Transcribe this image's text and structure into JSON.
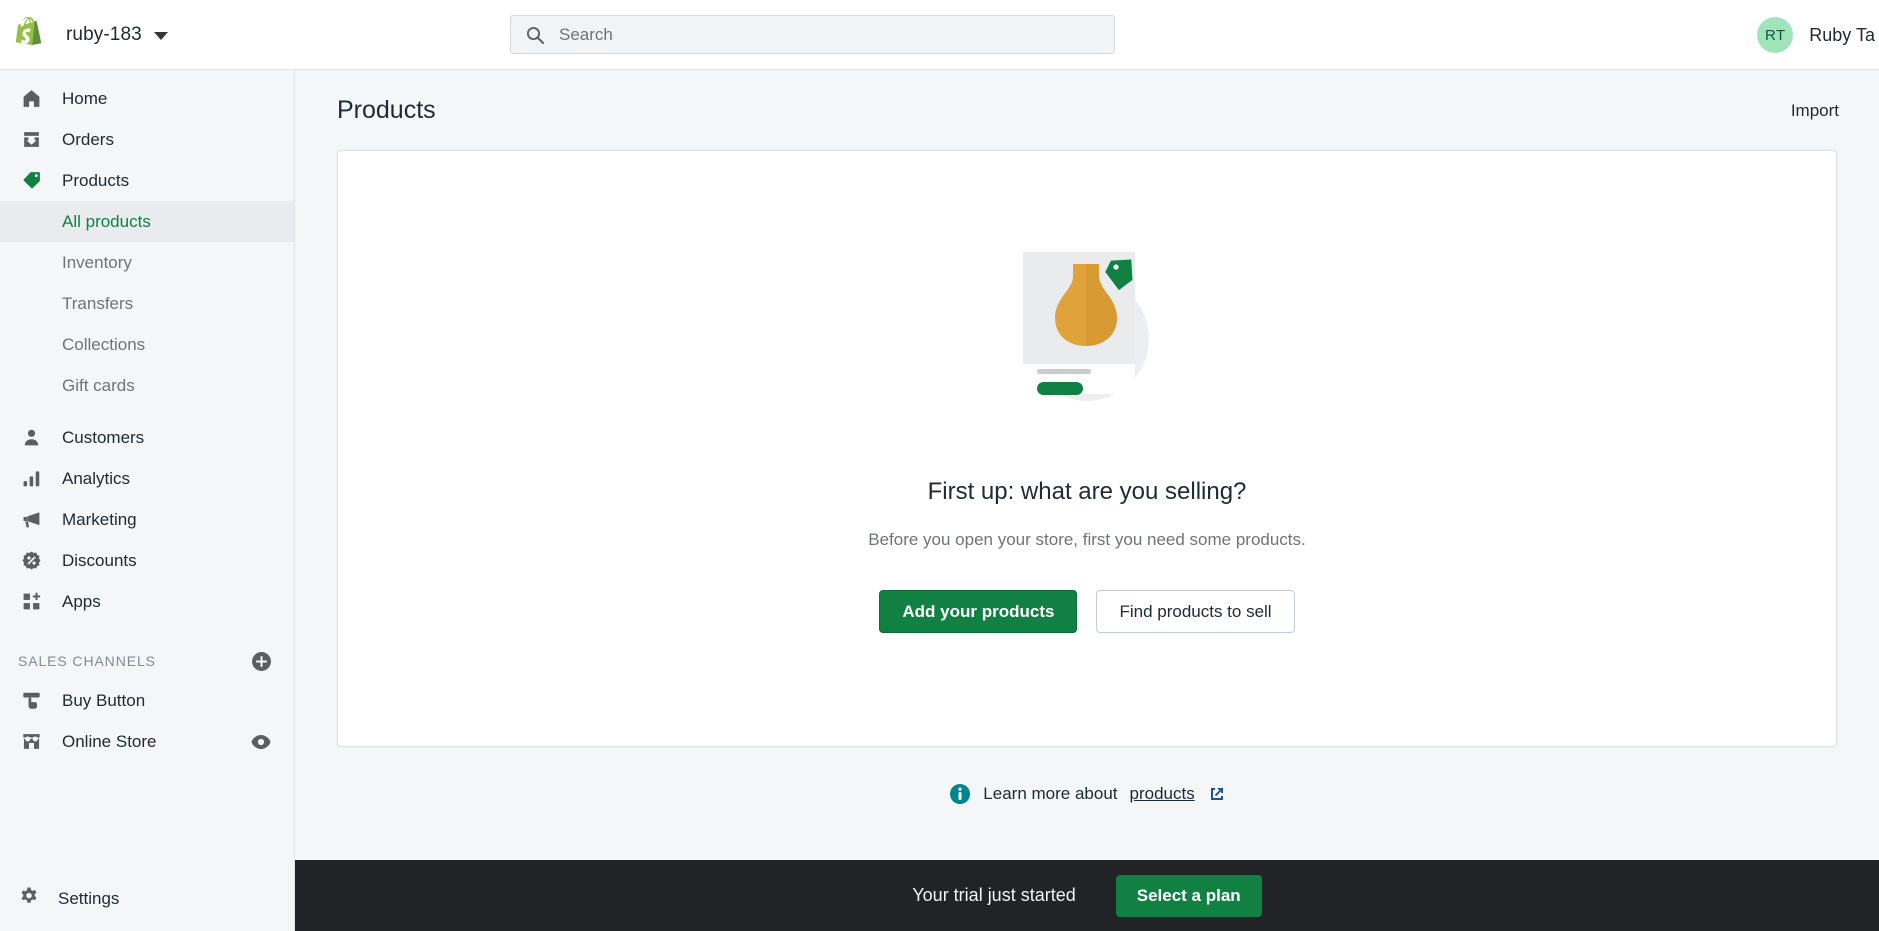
{
  "topbar": {
    "logo_icon": "shopify-bag-icon",
    "store_name": "ruby-183",
    "store_switcher_icon": "chevron-down-icon",
    "search": {
      "icon": "search-icon",
      "placeholder": "Search",
      "value": ""
    },
    "user": {
      "avatar_initials": "RT",
      "name": "Ruby Ta"
    }
  },
  "sidebar": {
    "items": [
      {
        "label": "Home",
        "icon": "home-icon"
      },
      {
        "label": "Orders",
        "icon": "orders-inbox-icon"
      },
      {
        "label": "Products",
        "icon": "product-tag-icon",
        "active": true
      }
    ],
    "sub_items": [
      {
        "label": "All products",
        "selected": true
      },
      {
        "label": "Inventory",
        "selected": false
      },
      {
        "label": "Transfers",
        "selected": false
      },
      {
        "label": "Collections",
        "selected": false
      },
      {
        "label": "Gift cards",
        "selected": false
      }
    ],
    "items2": [
      {
        "label": "Customers",
        "icon": "customer-person-icon"
      },
      {
        "label": "Analytics",
        "icon": "analytics-bars-icon"
      },
      {
        "label": "Marketing",
        "icon": "marketing-megaphone-icon"
      },
      {
        "label": "Discounts",
        "icon": "discount-percent-icon"
      },
      {
        "label": "Apps",
        "icon": "apps-grid-plus-icon"
      }
    ],
    "sales_channels": {
      "title": "SALES CHANNELS",
      "add_icon": "circle-plus-icon",
      "channels": [
        {
          "label": "Buy Button",
          "icon": "buy-button-icon"
        },
        {
          "label": "Online Store",
          "icon": "storefront-icon",
          "trailing_icon": "eye-icon"
        }
      ]
    },
    "settings": {
      "label": "Settings",
      "icon": "gear-icon"
    }
  },
  "main": {
    "page_title": "Products",
    "import_label": "Import",
    "empty_state": {
      "illustration": "product-card-vase-illustration",
      "headline": "First up: what are you selling?",
      "subtext": "Before you open your store, first you need some products.",
      "primary_button": "Add your products",
      "secondary_button": "Find products to sell"
    },
    "learn_more": {
      "info_icon": "info-circle-icon",
      "prefix": "Learn more about",
      "link_label": "products",
      "external_icon": "external-link-icon"
    }
  },
  "trial_banner": {
    "message": "Your trial just started",
    "cta_label": "Select a plan"
  },
  "colors": {
    "brand_green": "#108043",
    "shopify_logo_green": "#95bf47",
    "avatar_green": "#a0e4bb",
    "info_teal": "#00848e",
    "illustration_orange": "#e0a33b",
    "banner_dark": "#212326",
    "sidebar_bg": "#f4f6f8"
  }
}
